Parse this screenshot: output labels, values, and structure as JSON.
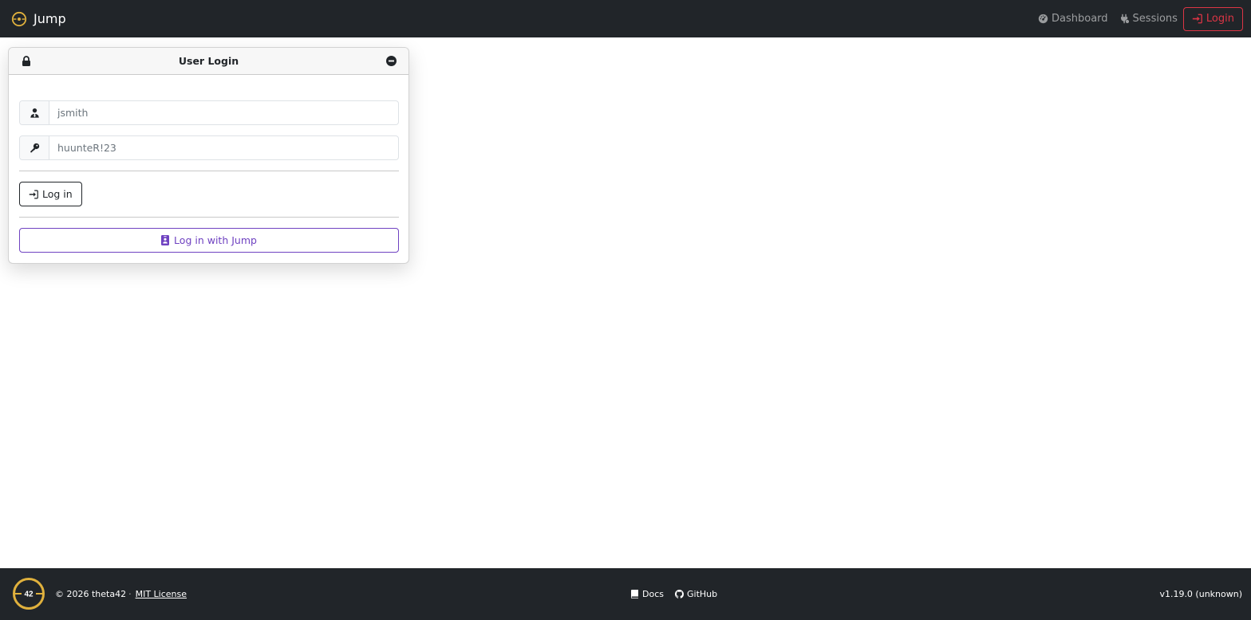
{
  "navbar": {
    "brand": "Jump",
    "logo_icon": "jump-logo-icon",
    "links": [
      {
        "label": "Dashboard",
        "icon": "gauge-icon"
      },
      {
        "label": "Sessions",
        "icon": "plug-icon"
      }
    ],
    "login_label": "Login",
    "login_icon": "sign-in-icon",
    "colors": {
      "background": "#212529",
      "login_accent": "#dc3545"
    }
  },
  "login_card": {
    "title": "User Login",
    "header_left_icon": "lock-icon",
    "header_right_icon": "minimize-icon",
    "username": {
      "value": "jsmith",
      "icon": "user-tie-icon"
    },
    "password": {
      "value": "huunteR!23",
      "icon": "key-icon"
    },
    "login_button": {
      "label": "Log in",
      "icon": "sign-in-icon"
    },
    "jump_button": {
      "label": "Log in with Jump",
      "icon": "id-badge-icon",
      "accent": "#6f42c1"
    }
  },
  "footer": {
    "logo_text": "42",
    "copyright": "© 2026 theta42",
    "separator": "·",
    "license_label": "MIT License",
    "links": [
      {
        "label": "Docs",
        "icon": "book-icon"
      },
      {
        "label": "GitHub",
        "icon": "github-icon"
      }
    ],
    "version": "v1.19.0 (unknown)",
    "colors": {
      "background": "#212529",
      "logo_gold": "#e0b13d"
    }
  }
}
